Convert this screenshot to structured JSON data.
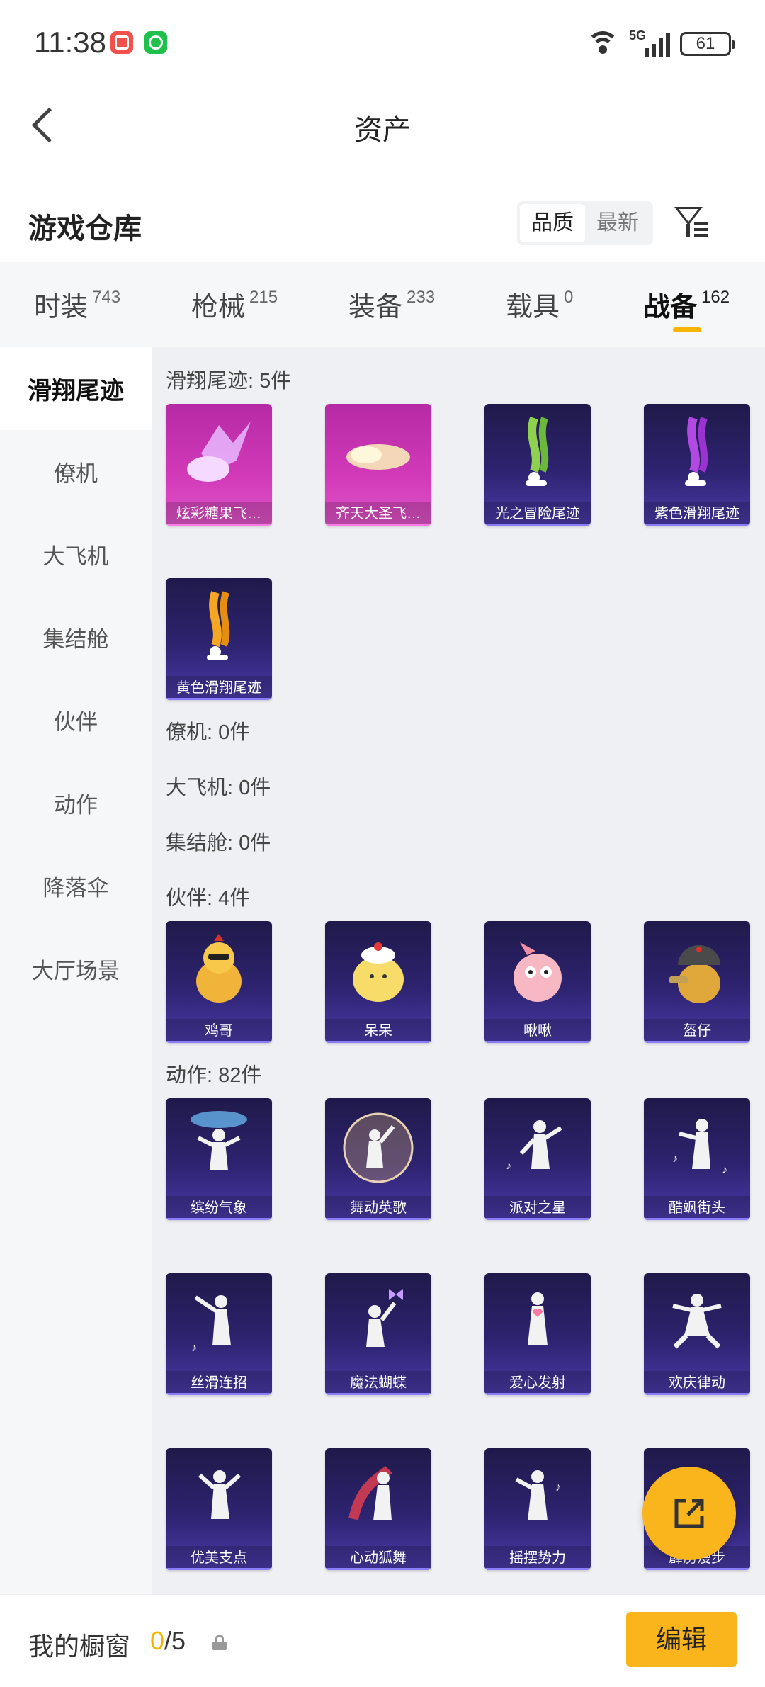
{
  "status_bar": {
    "time": "11:38",
    "network": "5G",
    "battery": "61",
    "icons": [
      "app-store-icon",
      "wechat-icon",
      "wifi-icon",
      "signal-icon",
      "battery-icon"
    ]
  },
  "header": {
    "title": "资产",
    "back_icon": "back-arrow-icon"
  },
  "warehouse": {
    "title": "游戏仓库",
    "sort_options": [
      "品质",
      "最新"
    ],
    "active_sort": "品质",
    "filter_icon": "filter-icon"
  },
  "tabs": [
    {
      "label": "时装",
      "count": "743"
    },
    {
      "label": "枪械",
      "count": "215"
    },
    {
      "label": "装备",
      "count": "233"
    },
    {
      "label": "载具",
      "count": "0"
    },
    {
      "label": "战备",
      "count": "162"
    }
  ],
  "active_tab": "战备",
  "accent_color": "#f5b400",
  "sidebar": {
    "items": [
      "滑翔尾迹",
      "僚机",
      "大飞机",
      "集结舱",
      "伙伴",
      "动作",
      "降落伞",
      "大厅场景"
    ],
    "active": "滑翔尾迹"
  },
  "sections": {
    "glide": {
      "label": "滑翔尾迹: 5件",
      "items": [
        "炫彩糖果飞…",
        "齐天大圣飞…",
        "光之冒险尾迹",
        "紫色滑翔尾迹",
        "黄色滑翔尾迹"
      ]
    },
    "wingman": {
      "label": "僚机: 0件"
    },
    "big_plane": {
      "label": "大飞机: 0件"
    },
    "rally": {
      "label": "集结舱: 0件"
    },
    "partner": {
      "label": "伙伴: 4件",
      "items": [
        "鸡哥",
        "呆呆",
        "啾啾",
        "盔仔"
      ]
    },
    "emote": {
      "label": "动作: 82件",
      "items": [
        "缤纷气象",
        "舞动英歌",
        "派对之星",
        "酷飒街头",
        "丝滑连招",
        "魔法蝴蝶",
        "爱心发射",
        "欢庆律动",
        "优美支点",
        "心动狐舞",
        "摇摆势力",
        "霹雳漫步"
      ]
    }
  },
  "fab": {
    "icon": "share-icon"
  },
  "bottom": {
    "showcase_label": "我的橱窗",
    "showcase_current": "0",
    "showcase_total": "/5",
    "edit_label": "编辑"
  }
}
